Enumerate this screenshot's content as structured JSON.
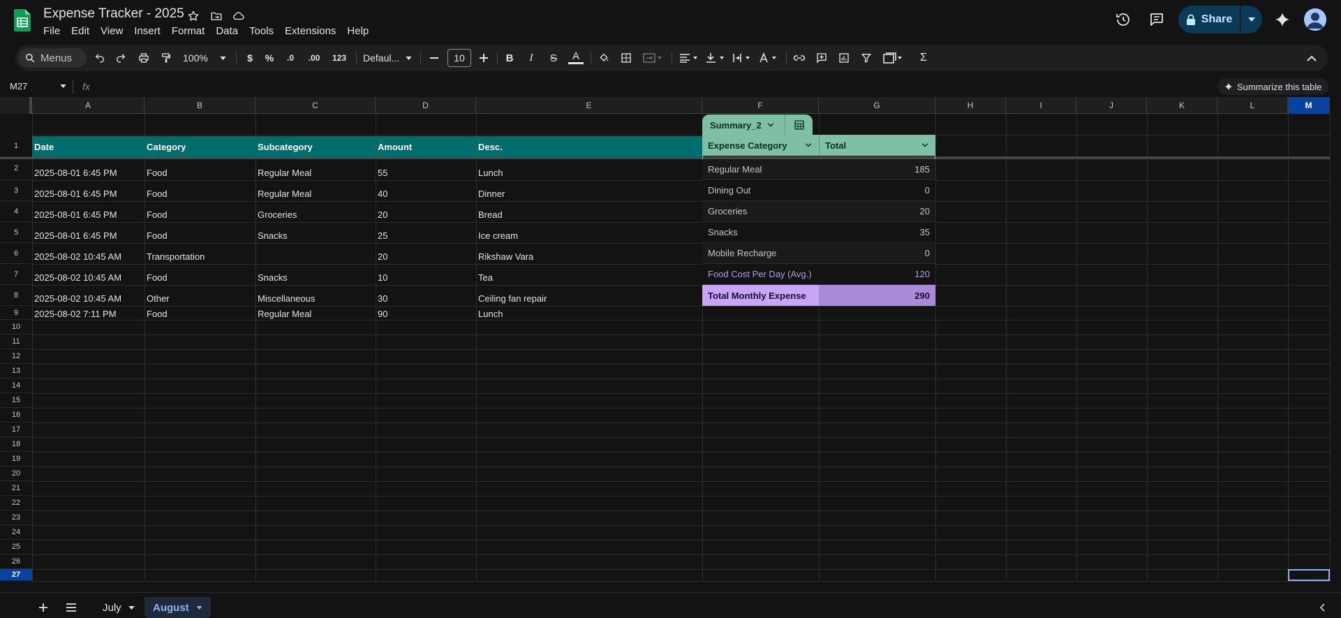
{
  "app": {
    "title": "Expense Tracker - 2025",
    "menu": [
      "File",
      "Edit",
      "View",
      "Insert",
      "Format",
      "Data",
      "Tools",
      "Extensions",
      "Help"
    ],
    "share_label": "Share"
  },
  "toolbar": {
    "search_placeholder": "Menus",
    "zoom": "100%",
    "currency": "$",
    "percent": "%",
    "dec_decrease": ".0",
    "dec_increase": ".00",
    "number_format": "123",
    "font": "Defaul...",
    "font_size": "10",
    "bold": "B",
    "italic": "I",
    "strike": "S",
    "text_color": "A",
    "sum": "Σ"
  },
  "formula_bar": {
    "name_box": "M27",
    "fx": "fx",
    "summarize": "Summarize this table"
  },
  "columns": [
    "A",
    "B",
    "C",
    "D",
    "E",
    "F",
    "G",
    "H",
    "I",
    "J",
    "K",
    "L",
    "M"
  ],
  "rows": [
    "1",
    "2",
    "3",
    "4",
    "5",
    "6",
    "7",
    "8",
    "9",
    "10",
    "11",
    "12",
    "13",
    "14",
    "15",
    "16",
    "17",
    "18",
    "19",
    "20",
    "21",
    "22",
    "23",
    "24",
    "25",
    "26",
    "27"
  ],
  "table": {
    "headers": [
      "Date",
      "Category",
      "Subcategory",
      "Amount",
      "Desc."
    ],
    "rows": [
      [
        "2025-08-01 6:45 PM",
        "Food",
        "Regular Meal",
        "55",
        "Lunch"
      ],
      [
        "2025-08-01 6:45 PM",
        "Food",
        "Regular Meal",
        "40",
        "Dinner"
      ],
      [
        "2025-08-01 6:45 PM",
        "Food",
        "Groceries",
        "20",
        "Bread"
      ],
      [
        "2025-08-01 6:45 PM",
        "Food",
        "Snacks",
        "25",
        "Ice cream"
      ],
      [
        "2025-08-02 10:45 AM",
        "Transportation",
        "",
        "20",
        "Rikshaw Vara"
      ],
      [
        "2025-08-02 10:45 AM",
        "Food",
        "Snacks",
        "10",
        "Tea"
      ],
      [
        "2025-08-02 10:45 AM",
        "Other",
        "Miscellaneous",
        "30",
        "Ceiling fan repair"
      ],
      [
        "2025-08-02 7:11 PM",
        "Food",
        "Regular Meal",
        "90",
        "Lunch"
      ]
    ]
  },
  "pivot": {
    "name": "Summary_2",
    "headers": [
      "Expense Category",
      "Total"
    ],
    "rows": [
      [
        "Regular Meal",
        "185"
      ],
      [
        "Dining Out",
        "0"
      ],
      [
        "Groceries",
        "20"
      ],
      [
        "Snacks",
        "35"
      ],
      [
        "Mobile Recharge",
        "0"
      ],
      [
        "Food Cost Per Day (Avg.)",
        "120"
      ],
      [
        "Total Monthly Expense",
        "290"
      ]
    ]
  },
  "sheets": [
    {
      "name": "July",
      "active": false
    },
    {
      "name": "August",
      "active": true
    }
  ],
  "colors": {
    "header_teal": "#006d6d",
    "pivot_green": "#7fbfa6",
    "total_purple": "#b39ddb",
    "accent_blue": "#8ab4f8"
  }
}
